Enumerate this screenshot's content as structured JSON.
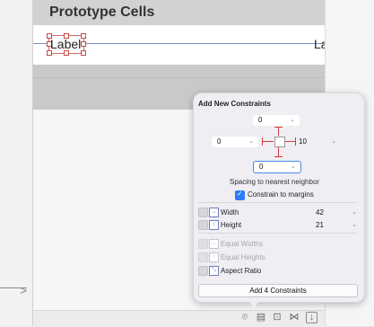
{
  "canvas": {
    "section_title": "Prototype Cells",
    "cell_label_left": "Label",
    "cell_label_right": "La"
  },
  "popover": {
    "title": "Add New Constraints",
    "top_value": "0",
    "left_value": "0",
    "right_value": "10",
    "bottom_value": "0",
    "spacing_text": "Spacing to nearest neighbor",
    "constrain_to_margins_label": "Constrain to margins",
    "constrain_to_margins_checked": true,
    "width": {
      "label": "Width",
      "value": "42",
      "checked": false
    },
    "height": {
      "label": "Height",
      "value": "21",
      "checked": false
    },
    "equal_widths_label": "Equal Widths",
    "equal_heights_label": "Equal Heights",
    "aspect_ratio_label": "Aspect Ratio",
    "add_button_label": "Add 4 Constraints"
  },
  "bottom_toolbar": {
    "icons": [
      "update-frames-icon",
      "align-icon",
      "add-constraints-icon",
      "resolve-issues-icon",
      "embed-in-icon"
    ]
  },
  "colors": {
    "accent": "#2f7bf5",
    "strut": "#d23b3b",
    "popover_bg": "#f0eef3"
  }
}
